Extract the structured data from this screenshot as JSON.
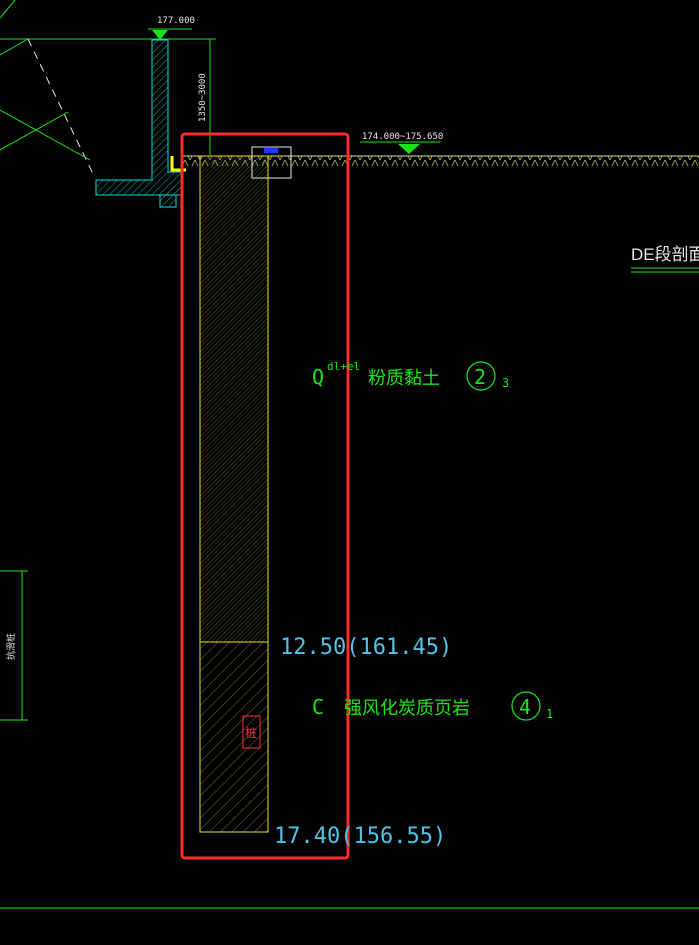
{
  "section_title": "DE段剖面图",
  "levels": {
    "top_wall": "177.000",
    "ground": "174.000~175.650",
    "wall_dim": "1350~3000"
  },
  "layers": [
    {
      "symbol": "Q",
      "superscript": "dl+el",
      "name": "粉质黏土",
      "circle_num": "2",
      "subscript": "3",
      "boundary_label": "12.50(161.45)"
    },
    {
      "symbol": "C",
      "superscript": "",
      "name": "强风化炭质页岩",
      "circle_num": "4",
      "subscript": "1",
      "boundary_label": "17.40(156.55)"
    }
  ],
  "left_side_label": "抗滑桩",
  "pile_tag": "桩",
  "colors": {
    "background": "#000000",
    "green": "#19e619",
    "cyan": "#4fc3e8",
    "yellow": "#e6e619",
    "highlight": "#ff2a2a",
    "hatch": "#8a8a4a",
    "wall": "#00e0e0"
  }
}
